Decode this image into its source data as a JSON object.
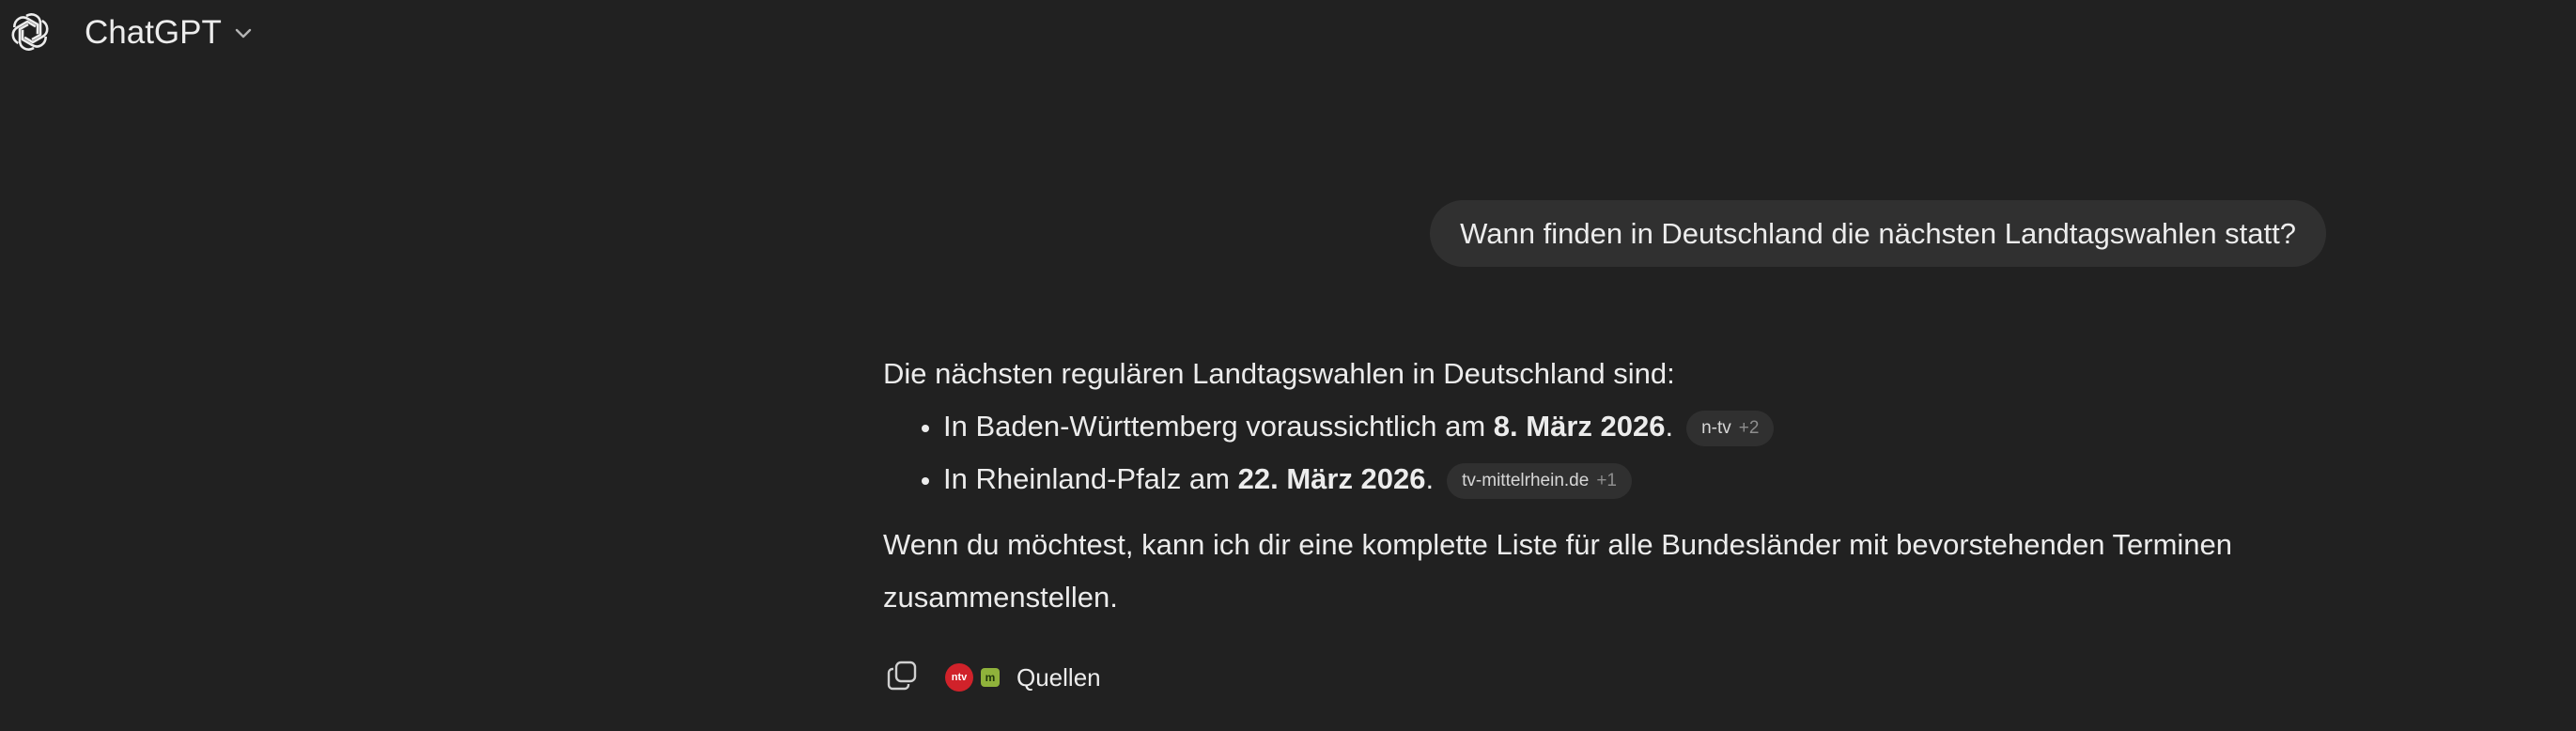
{
  "header": {
    "model_name": "ChatGPT",
    "logo_icon": "openai-logo-icon",
    "chevron_icon": "chevron-down-icon"
  },
  "user_message": {
    "text": "Wann finden in Deutschland die nächsten Landtagswahlen statt?"
  },
  "assistant": {
    "intro": "Die nächsten regulären Landtagswahlen in Deutschland sind:",
    "items": [
      {
        "prefix": "In Baden-Württemberg voraussichtlich am ",
        "date": "8. März 2026",
        "suffix": ".",
        "source_name": "n-tv",
        "source_more": "+2"
      },
      {
        "prefix": "In Rheinland-Pfalz am ",
        "date": "22. März 2026",
        "suffix": ".",
        "source_name": "tv-mittelrhein.de",
        "source_more": "+1"
      }
    ],
    "outro": "Wenn du möchtest, kann ich dir eine komplette Liste für alle Bundesländer mit bevorstehenden Terminen zusammenstellen."
  },
  "actions": {
    "copy_icon": "copy-icon",
    "sources_label": "Quellen",
    "favicons": [
      "ntv",
      "m"
    ]
  },
  "colors": {
    "background": "#212121",
    "bubble": "#303030",
    "text": "#ececec",
    "ntv_red": "#d0222a",
    "mittelrhein_green": "#8fb23b"
  }
}
